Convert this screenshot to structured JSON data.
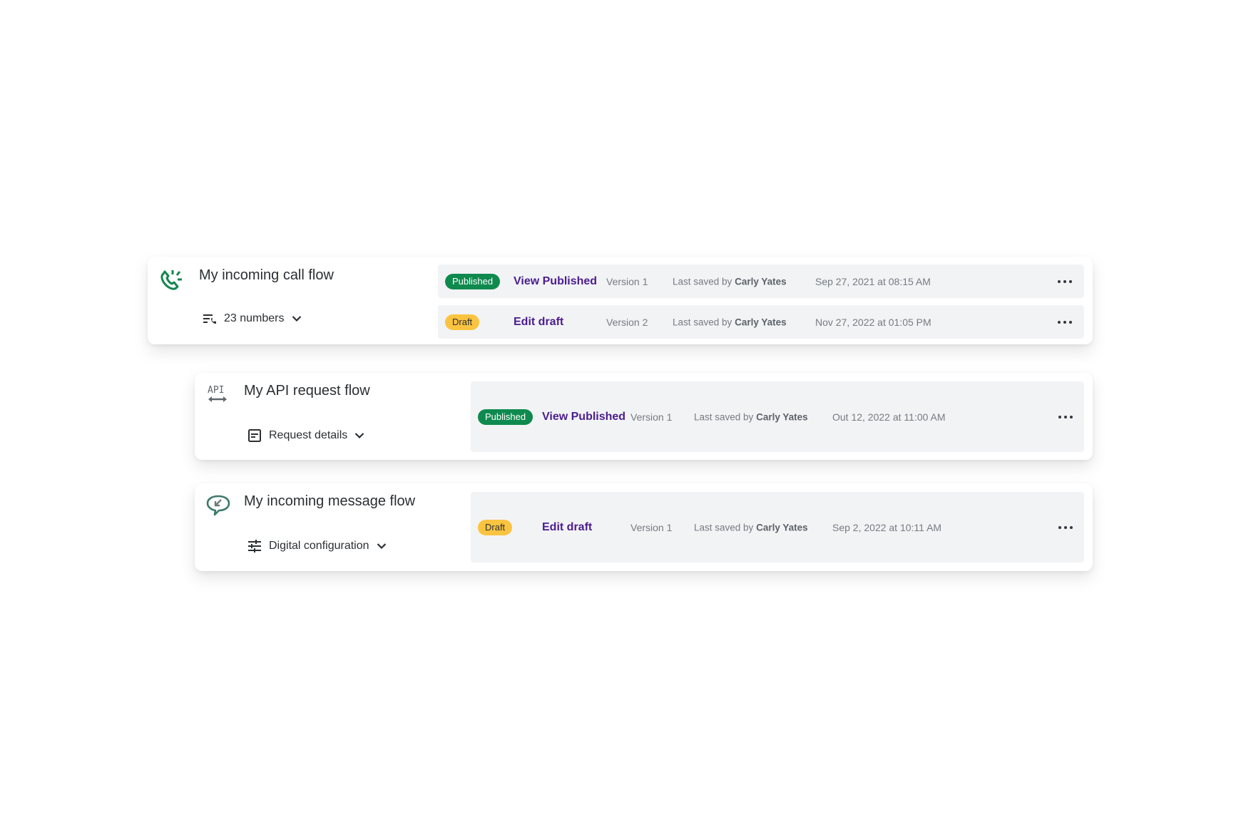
{
  "flows": [
    {
      "title": "My incoming call flow",
      "icon": "incoming-call-icon",
      "meta": {
        "icon": "phone-list-icon",
        "label": "23 numbers"
      },
      "versions": [
        {
          "status": "Published",
          "action": "View Published",
          "version": "Version 1",
          "saved_prefix": "Last saved by",
          "saved_by": "Carly Yates",
          "date": "Sep 27, 2021 at 08:15 AM"
        },
        {
          "status": "Draft",
          "action": "Edit draft",
          "version": "Version 2",
          "saved_prefix": "Last saved by",
          "saved_by": "Carly Yates",
          "date": "Nov 27, 2022 at 01:05 PM"
        }
      ]
    },
    {
      "title": "My API request flow",
      "icon": "api-icon",
      "meta": {
        "icon": "document-icon",
        "label": "Request details"
      },
      "versions": [
        {
          "status": "Published",
          "action": "View Published",
          "version": "Version 1",
          "saved_prefix": "Last saved by",
          "saved_by": "Carly Yates",
          "date": "Out 12, 2022 at 11:00 AM"
        }
      ]
    },
    {
      "title": "My incoming message flow",
      "icon": "incoming-message-icon",
      "meta": {
        "icon": "sliders-icon",
        "label": "Digital configuration"
      },
      "versions": [
        {
          "status": "Draft",
          "action": "Edit draft",
          "version": "Version 1",
          "saved_prefix": "Last saved by",
          "saved_by": "Carly Yates",
          "date": "Sep 2, 2022 at 10:11 AM"
        }
      ]
    }
  ],
  "colors": {
    "published": "#0f8a4f",
    "draft": "#fbc440",
    "link": "#4b1d8f",
    "call_icon": "#13864f",
    "message_icon": "#3d7a6a"
  }
}
